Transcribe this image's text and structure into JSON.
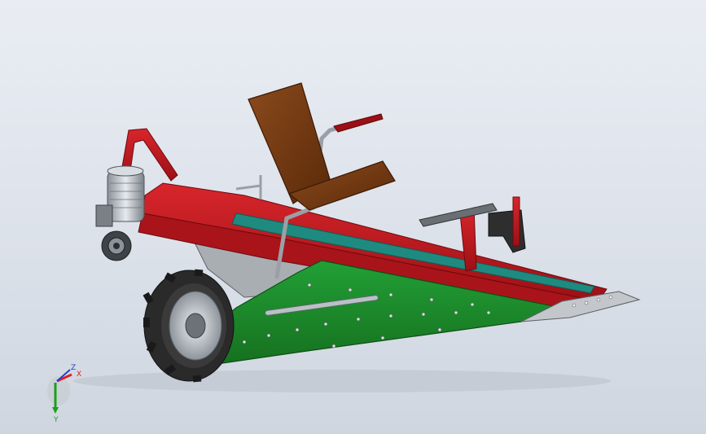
{
  "viewport": {
    "background_top": "#e9edf3",
    "background_bottom": "#cfd6e0"
  },
  "colors": {
    "frame_red": "#c4161c",
    "frame_red_dark": "#8e0d12",
    "side_green": "#1f8a2e",
    "side_green_dark": "#14621f",
    "belt_teal": "#1f8a80",
    "seat_brown": "#7a3b12",
    "metal_gray": "#9aa0a6",
    "tire_dark": "#2a2a2a",
    "motor_silver": "#c9ced4"
  },
  "model": {
    "parts": [
      "main-frame",
      "conveyor-belt",
      "side-panel",
      "operator-seat",
      "electric-motor",
      "drive-wheel",
      "front-tow-handle",
      "rear-control-bracket",
      "digging-blade"
    ]
  },
  "triad": {
    "x_label": "X",
    "y_label": "Y",
    "z_label": "Z",
    "x_color": "#e02020",
    "y_color": "#1aa01a",
    "z_color": "#2040d0"
  }
}
